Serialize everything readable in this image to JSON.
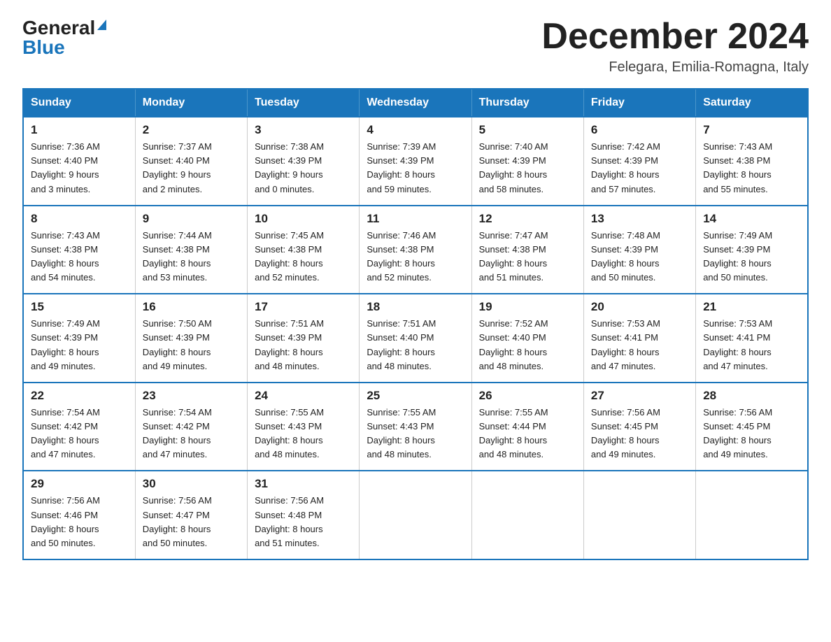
{
  "header": {
    "logo_general": "General",
    "logo_blue": "Blue",
    "month_title": "December 2024",
    "location": "Felegara, Emilia-Romagna, Italy"
  },
  "days_of_week": [
    "Sunday",
    "Monday",
    "Tuesday",
    "Wednesday",
    "Thursday",
    "Friday",
    "Saturday"
  ],
  "weeks": [
    [
      {
        "day": "1",
        "sunrise": "7:36 AM",
        "sunset": "4:40 PM",
        "daylight": "9 hours and 3 minutes."
      },
      {
        "day": "2",
        "sunrise": "7:37 AM",
        "sunset": "4:40 PM",
        "daylight": "9 hours and 2 minutes."
      },
      {
        "day": "3",
        "sunrise": "7:38 AM",
        "sunset": "4:39 PM",
        "daylight": "9 hours and 0 minutes."
      },
      {
        "day": "4",
        "sunrise": "7:39 AM",
        "sunset": "4:39 PM",
        "daylight": "8 hours and 59 minutes."
      },
      {
        "day": "5",
        "sunrise": "7:40 AM",
        "sunset": "4:39 PM",
        "daylight": "8 hours and 58 minutes."
      },
      {
        "day": "6",
        "sunrise": "7:42 AM",
        "sunset": "4:39 PM",
        "daylight": "8 hours and 57 minutes."
      },
      {
        "day": "7",
        "sunrise": "7:43 AM",
        "sunset": "4:38 PM",
        "daylight": "8 hours and 55 minutes."
      }
    ],
    [
      {
        "day": "8",
        "sunrise": "7:43 AM",
        "sunset": "4:38 PM",
        "daylight": "8 hours and 54 minutes."
      },
      {
        "day": "9",
        "sunrise": "7:44 AM",
        "sunset": "4:38 PM",
        "daylight": "8 hours and 53 minutes."
      },
      {
        "day": "10",
        "sunrise": "7:45 AM",
        "sunset": "4:38 PM",
        "daylight": "8 hours and 52 minutes."
      },
      {
        "day": "11",
        "sunrise": "7:46 AM",
        "sunset": "4:38 PM",
        "daylight": "8 hours and 52 minutes."
      },
      {
        "day": "12",
        "sunrise": "7:47 AM",
        "sunset": "4:38 PM",
        "daylight": "8 hours and 51 minutes."
      },
      {
        "day": "13",
        "sunrise": "7:48 AM",
        "sunset": "4:39 PM",
        "daylight": "8 hours and 50 minutes."
      },
      {
        "day": "14",
        "sunrise": "7:49 AM",
        "sunset": "4:39 PM",
        "daylight": "8 hours and 50 minutes."
      }
    ],
    [
      {
        "day": "15",
        "sunrise": "7:49 AM",
        "sunset": "4:39 PM",
        "daylight": "8 hours and 49 minutes."
      },
      {
        "day": "16",
        "sunrise": "7:50 AM",
        "sunset": "4:39 PM",
        "daylight": "8 hours and 49 minutes."
      },
      {
        "day": "17",
        "sunrise": "7:51 AM",
        "sunset": "4:39 PM",
        "daylight": "8 hours and 48 minutes."
      },
      {
        "day": "18",
        "sunrise": "7:51 AM",
        "sunset": "4:40 PM",
        "daylight": "8 hours and 48 minutes."
      },
      {
        "day": "19",
        "sunrise": "7:52 AM",
        "sunset": "4:40 PM",
        "daylight": "8 hours and 48 minutes."
      },
      {
        "day": "20",
        "sunrise": "7:53 AM",
        "sunset": "4:41 PM",
        "daylight": "8 hours and 47 minutes."
      },
      {
        "day": "21",
        "sunrise": "7:53 AM",
        "sunset": "4:41 PM",
        "daylight": "8 hours and 47 minutes."
      }
    ],
    [
      {
        "day": "22",
        "sunrise": "7:54 AM",
        "sunset": "4:42 PM",
        "daylight": "8 hours and 47 minutes."
      },
      {
        "day": "23",
        "sunrise": "7:54 AM",
        "sunset": "4:42 PM",
        "daylight": "8 hours and 47 minutes."
      },
      {
        "day": "24",
        "sunrise": "7:55 AM",
        "sunset": "4:43 PM",
        "daylight": "8 hours and 48 minutes."
      },
      {
        "day": "25",
        "sunrise": "7:55 AM",
        "sunset": "4:43 PM",
        "daylight": "8 hours and 48 minutes."
      },
      {
        "day": "26",
        "sunrise": "7:55 AM",
        "sunset": "4:44 PM",
        "daylight": "8 hours and 48 minutes."
      },
      {
        "day": "27",
        "sunrise": "7:56 AM",
        "sunset": "4:45 PM",
        "daylight": "8 hours and 49 minutes."
      },
      {
        "day": "28",
        "sunrise": "7:56 AM",
        "sunset": "4:45 PM",
        "daylight": "8 hours and 49 minutes."
      }
    ],
    [
      {
        "day": "29",
        "sunrise": "7:56 AM",
        "sunset": "4:46 PM",
        "daylight": "8 hours and 50 minutes."
      },
      {
        "day": "30",
        "sunrise": "7:56 AM",
        "sunset": "4:47 PM",
        "daylight": "8 hours and 50 minutes."
      },
      {
        "day": "31",
        "sunrise": "7:56 AM",
        "sunset": "4:48 PM",
        "daylight": "8 hours and 51 minutes."
      },
      null,
      null,
      null,
      null
    ]
  ],
  "labels": {
    "sunrise": "Sunrise:",
    "sunset": "Sunset:",
    "daylight": "Daylight:"
  }
}
